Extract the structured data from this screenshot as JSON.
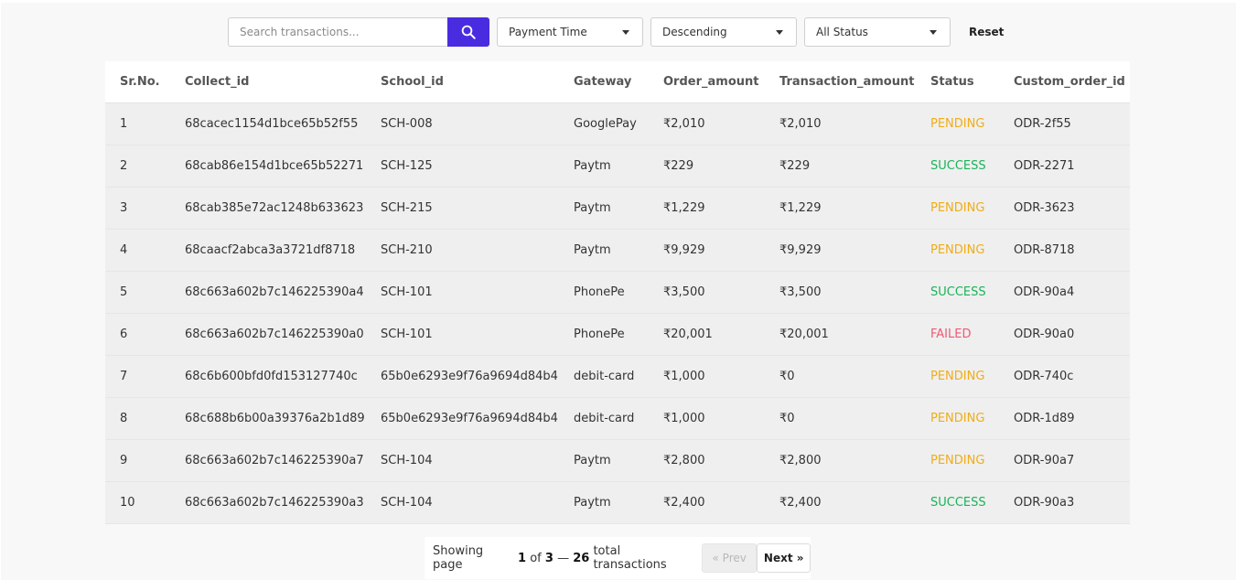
{
  "toolbar": {
    "search_placeholder": "Search transactions...",
    "search_icon": "search-icon",
    "sort_field": "Payment Time",
    "sort_order": "Descending",
    "status_filter": "All Status",
    "reset_label": "Reset"
  },
  "colors": {
    "accent": "#4a2ce0",
    "pending": "#f0ad16",
    "success": "#1bb35a",
    "failed": "#ee5a72"
  },
  "table": {
    "headers": [
      "Sr.No.",
      "Collect_id",
      "School_id",
      "Gateway",
      "Order_amount",
      "Transaction_amount",
      "Status",
      "Custom_order_id"
    ],
    "rows": [
      [
        "1",
        "68cacec1154d1bce65b52f55",
        "SCH-008",
        "GooglePay",
        "₹2,010",
        "₹2,010",
        "PENDING",
        "ODR-2f55"
      ],
      [
        "2",
        "68cab86e154d1bce65b52271",
        "SCH-125",
        "Paytm",
        "₹229",
        "₹229",
        "SUCCESS",
        "ODR-2271"
      ],
      [
        "3",
        "68cab385e72ac1248b633623",
        "SCH-215",
        "Paytm",
        "₹1,229",
        "₹1,229",
        "PENDING",
        "ODR-3623"
      ],
      [
        "4",
        "68caacf2abca3a3721df8718",
        "SCH-210",
        "Paytm",
        "₹9,929",
        "₹9,929",
        "PENDING",
        "ODR-8718"
      ],
      [
        "5",
        "68c663a602b7c146225390a4",
        "SCH-101",
        "PhonePe",
        "₹3,500",
        "₹3,500",
        "SUCCESS",
        "ODR-90a4"
      ],
      [
        "6",
        "68c663a602b7c146225390a0",
        "SCH-101",
        "PhonePe",
        "₹20,001",
        "₹20,001",
        "FAILED",
        "ODR-90a0"
      ],
      [
        "7",
        "68c6b600bfd0fd153127740c",
        "65b0e6293e9f76a9694d84b4",
        "debit-card",
        "₹1,000",
        "₹0",
        "PENDING",
        "ODR-740c"
      ],
      [
        "8",
        "68c688b6b00a39376a2b1d89",
        "65b0e6293e9f76a9694d84b4",
        "debit-card",
        "₹1,000",
        "₹0",
        "PENDING",
        "ODR-1d89"
      ],
      [
        "9",
        "68c663a602b7c146225390a7",
        "SCH-104",
        "Paytm",
        "₹2,800",
        "₹2,800",
        "PENDING",
        "ODR-90a7"
      ],
      [
        "10",
        "68c663a602b7c146225390a3",
        "SCH-104",
        "Paytm",
        "₹2,400",
        "₹2,400",
        "SUCCESS",
        "ODR-90a3"
      ]
    ]
  },
  "pagination": {
    "prefix": "Showing page",
    "current_page": "1",
    "of_word": "of",
    "total_pages": "3",
    "dash": "—",
    "total_count": "26",
    "suffix": "total transactions",
    "prev_label": "« Prev",
    "next_label": "Next »"
  }
}
